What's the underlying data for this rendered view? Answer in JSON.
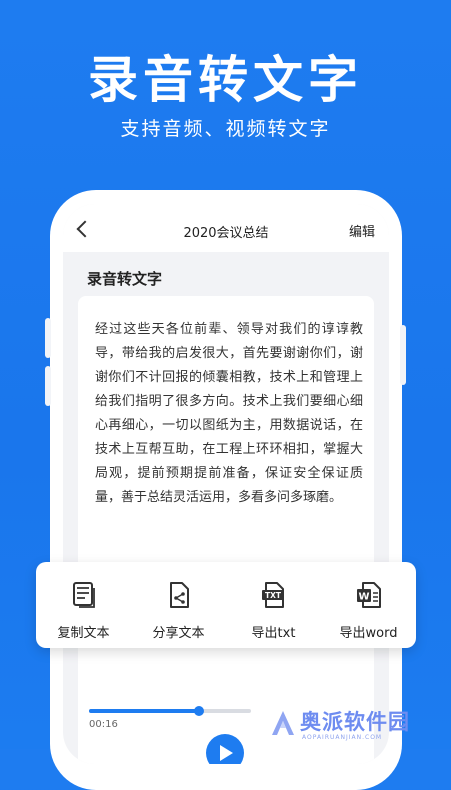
{
  "hero": {
    "title": "录音转文字",
    "subtitle": "支持音频、视频转文字"
  },
  "navbar": {
    "back_icon": "chevron-left-icon",
    "title": "2020会议总结",
    "edit_label": "编辑"
  },
  "section": {
    "title": "录音转文字"
  },
  "content": {
    "text": "经过这些天各位前辈、领导对我们的谆谆教导，带给我的启发很大，首先要谢谢你们，谢谢你们不计回报的倾囊相教，技术上和管理上给我们指明了很多方向。技术上我们要细心细心再细心，一切以图纸为主，用数据说话，在技术上互帮互助，在工程上环环相扣，掌握大局观，提前预期提前准备，保证安全保证质量，善于总结灵活运用，多看多问多琢磨。"
  },
  "player": {
    "current_time": "00:16",
    "progress_fraction": 0.68,
    "play_icon": "play-icon"
  },
  "actions": [
    {
      "label": "复制文本",
      "icon": "copy-document-icon"
    },
    {
      "label": "分享文本",
      "icon": "share-document-icon"
    },
    {
      "label": "导出txt",
      "icon": "txt-file-icon"
    },
    {
      "label": "导出word",
      "icon": "word-file-icon"
    }
  ],
  "watermark": {
    "text": "奥派软件园",
    "subtext": "AOPAIRUANJIAN.COM",
    "logo_icon": "aopai-logo-icon"
  },
  "colors": {
    "brand_blue": "#1e7cf0",
    "background": "#1a76ec",
    "text": "#222222"
  }
}
